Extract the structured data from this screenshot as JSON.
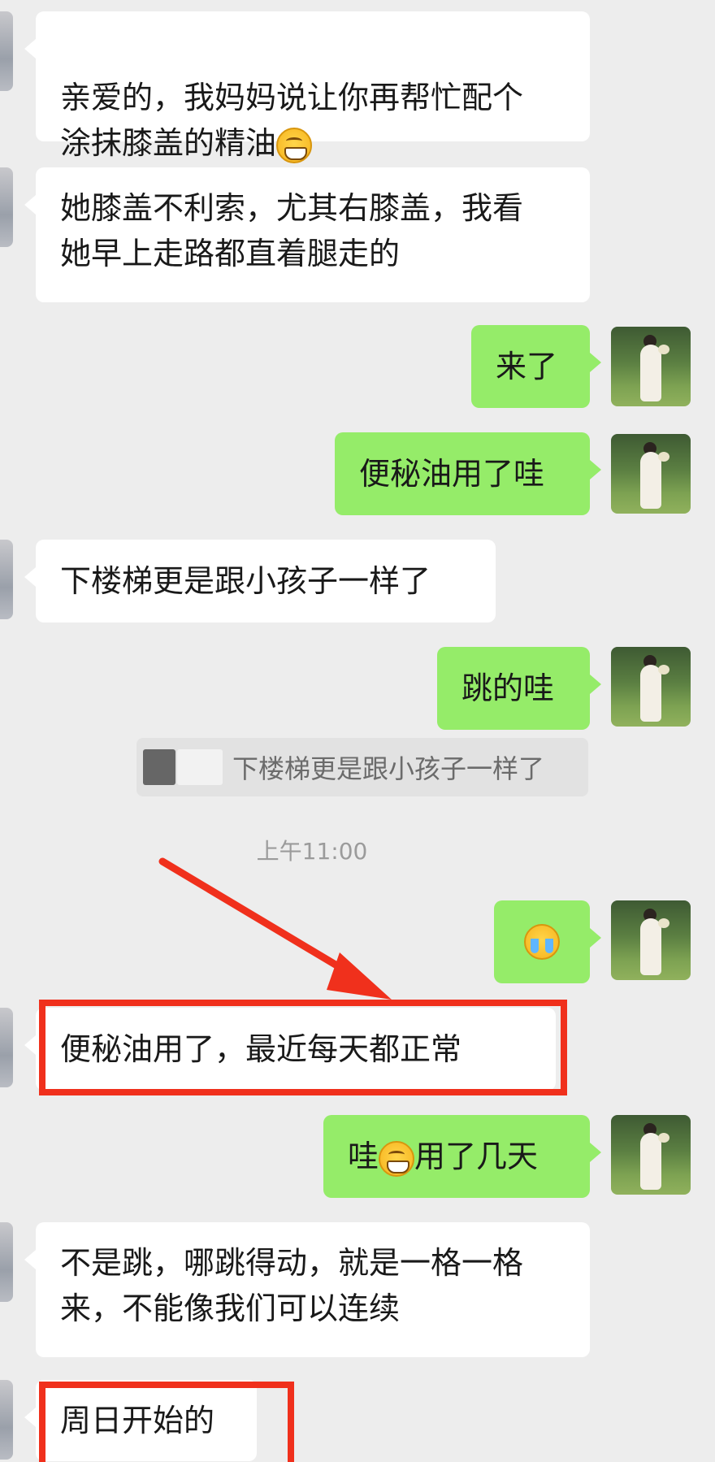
{
  "messages": [
    {
      "side": "left",
      "text": "亲爱的，我妈妈说让你再帮忙配个\n涂抹膝盖的精油",
      "emoji": "grin"
    },
    {
      "side": "left",
      "text": "她膝盖不利索，尤其右膝盖，我看\n她早上走路都直着腿走的"
    },
    {
      "side": "right",
      "text": "来了"
    },
    {
      "side": "right",
      "text": "便秘油用了哇"
    },
    {
      "side": "left",
      "text": "下楼梯更是跟小孩子一样了"
    },
    {
      "side": "right",
      "text": "跳的哇"
    },
    {
      "side": "right",
      "text": "",
      "emoji": "cry"
    },
    {
      "side": "left",
      "text": "便秘油用了，最近每天都正常"
    },
    {
      "side": "right",
      "text_before": "哇",
      "emoji": "grin",
      "text_after": "用了几天"
    },
    {
      "side": "left",
      "text": "不是跳，哪跳得动，就是一格一格\n来，不能像我们可以连续"
    },
    {
      "side": "left",
      "text": "周日开始的"
    }
  ],
  "quote": {
    "text": "下楼梯更是跟小孩子一样了"
  },
  "timestamp": "上午11:00",
  "colors": {
    "annotation_red": "#f0301c",
    "right_bubble": "#95ec69",
    "left_bubble": "#ffffff",
    "background": "#ededed"
  }
}
